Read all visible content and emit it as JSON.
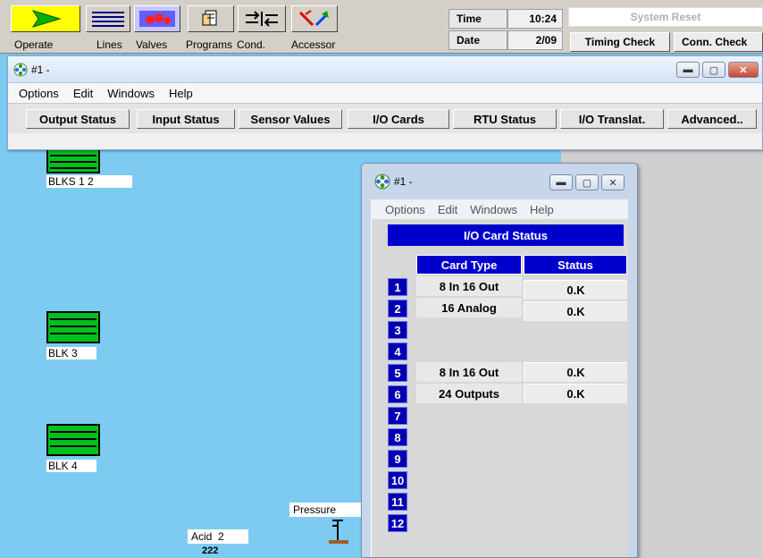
{
  "toolbar": {
    "buttons": [
      {
        "label": "Operate",
        "icon": "play-arrow-icon"
      },
      {
        "label": "Lines",
        "icon": "lines-icon"
      },
      {
        "label": "Valves",
        "icon": "valves-icon"
      },
      {
        "label": "Programs",
        "icon": "programs-icon"
      },
      {
        "label": "Cond.",
        "icon": "conditions-icon"
      },
      {
        "label": "Accessor",
        "icon": "accessories-icon"
      }
    ],
    "time_label": "Time",
    "time_value": "10:24",
    "date_label": "Date",
    "date_value": "2/09",
    "system_reset": "System Reset",
    "timing_check": "Timing Check",
    "conn_check": "Conn. Check"
  },
  "main_window": {
    "title": "#1 -",
    "menu": [
      "Options",
      "Edit",
      "Windows",
      "Help"
    ],
    "tabs": [
      "Output Status",
      "Input Status",
      "Sensor Values",
      "I/O Cards",
      "RTU Status",
      "I/O Translat.",
      "Advanced.."
    ]
  },
  "canvas": {
    "blocks": [
      {
        "label": "BLKS 1 2"
      },
      {
        "label": "BLK 3"
      },
      {
        "label": "BLK 4"
      }
    ],
    "pressure_label": "Pressure",
    "acid_label": "Acid",
    "acid_num": "2",
    "acid_sub": "222"
  },
  "io_window": {
    "title": "#1 -",
    "menu": [
      "Options",
      "Edit",
      "Windows",
      "Help"
    ],
    "table_title": "I/O Card Status",
    "col_card_type": "Card Type",
    "col_status": "Status",
    "rows": [
      {
        "num": "1",
        "type": "8 In 16 Out",
        "status": "0.K"
      },
      {
        "num": "2",
        "type": "16 Analog",
        "status": "0.K"
      },
      {
        "num": "3",
        "type": "",
        "status": ""
      },
      {
        "num": "4",
        "type": "",
        "status": ""
      },
      {
        "num": "5",
        "type": "8 In 16 Out",
        "status": "0.K"
      },
      {
        "num": "6",
        "type": "24 Outputs",
        "status": "0.K"
      },
      {
        "num": "7",
        "type": "",
        "status": ""
      },
      {
        "num": "8",
        "type": "",
        "status": ""
      },
      {
        "num": "9",
        "type": "",
        "status": ""
      },
      {
        "num": "10",
        "type": "",
        "status": ""
      },
      {
        "num": "11",
        "type": "",
        "status": ""
      },
      {
        "num": "12",
        "type": "",
        "status": ""
      }
    ]
  }
}
